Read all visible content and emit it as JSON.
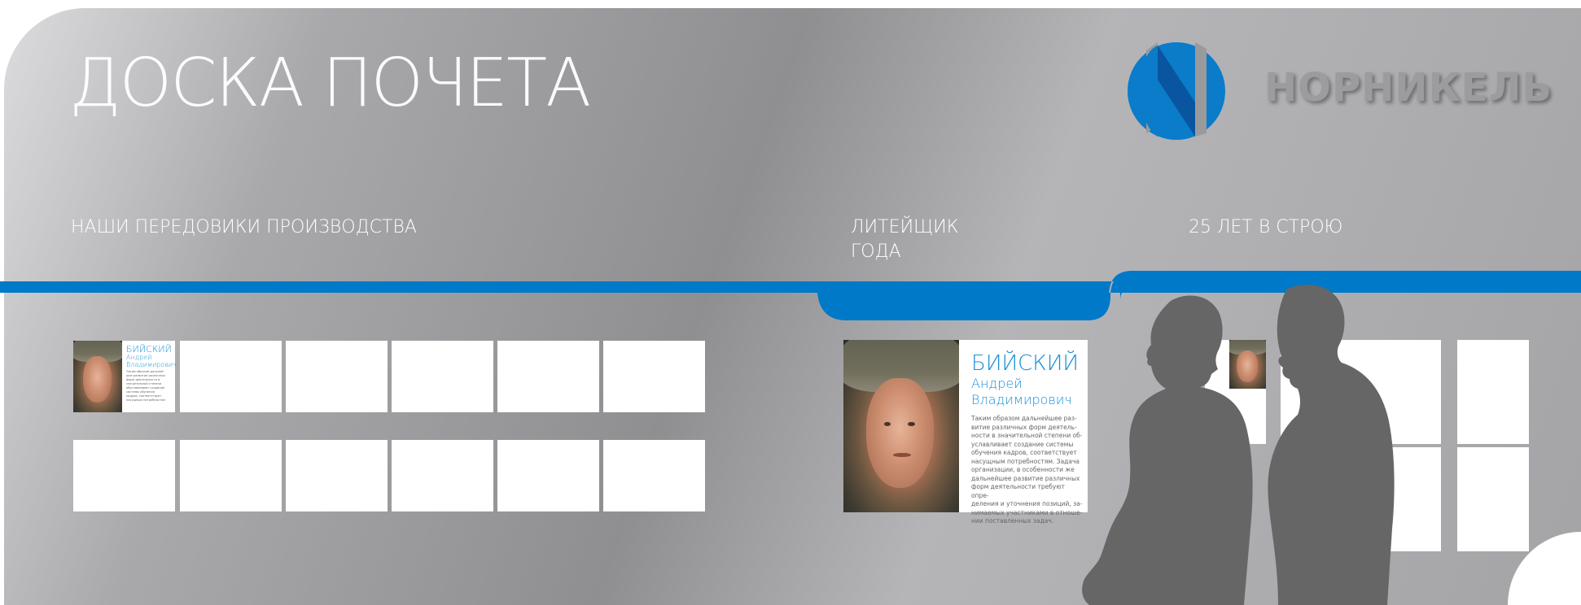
{
  "board": {
    "title": "ДОСКА ПОЧЕТА",
    "logo_text": "НОРНИКЕЛЬ",
    "sections": {
      "advanced_workers": "НАШИ ПЕРЕДОВИКИ ПРОИЗВОДСТВА",
      "caster_line1": "ЛИТЕЙЩИК",
      "caster_line2": "ГОДА",
      "years25": "25 ЛЕТ В СТРОЮ"
    },
    "featured": {
      "surname": "БИЙСКИЙ",
      "name": "Андрей",
      "patronymic": "Владимирович",
      "text_lines": [
        "Таким образом дальнейшее раз-",
        "витие различных форм деятель-",
        "ности в значительной степени об-",
        "уславливает создание системы",
        "обучения кадров, соответствует",
        "насущным потребностям. Задача",
        "организации, в особенности же",
        "дальнейшее развитие различных",
        "форм деятельности требуют опре-",
        "деления и уточнения позиций, за-",
        "нимаемых участниками в отноше-",
        "нии поставленных задач."
      ]
    },
    "small_card": {
      "surname": "БИЙСКИЙ",
      "name": "Андрей",
      "patronymic": "Владимирович",
      "text_lines": [
        "Таким образом дальней",
        "шее развитие различных",
        "форм деятельности в",
        "значительной степени",
        "обуславливает создание",
        "системы обучения",
        "кадров, соответствует",
        "насущным потребностям"
      ]
    }
  },
  "colors": {
    "accent_blue": "#0079c8",
    "name_blue": "#1a8fd6",
    "logo_dark_blue": "#0a5aa4",
    "silhouette": "#666666"
  },
  "icons": {
    "logo": "nornickel-logo-icon",
    "people": "people-silhouettes-icon"
  }
}
